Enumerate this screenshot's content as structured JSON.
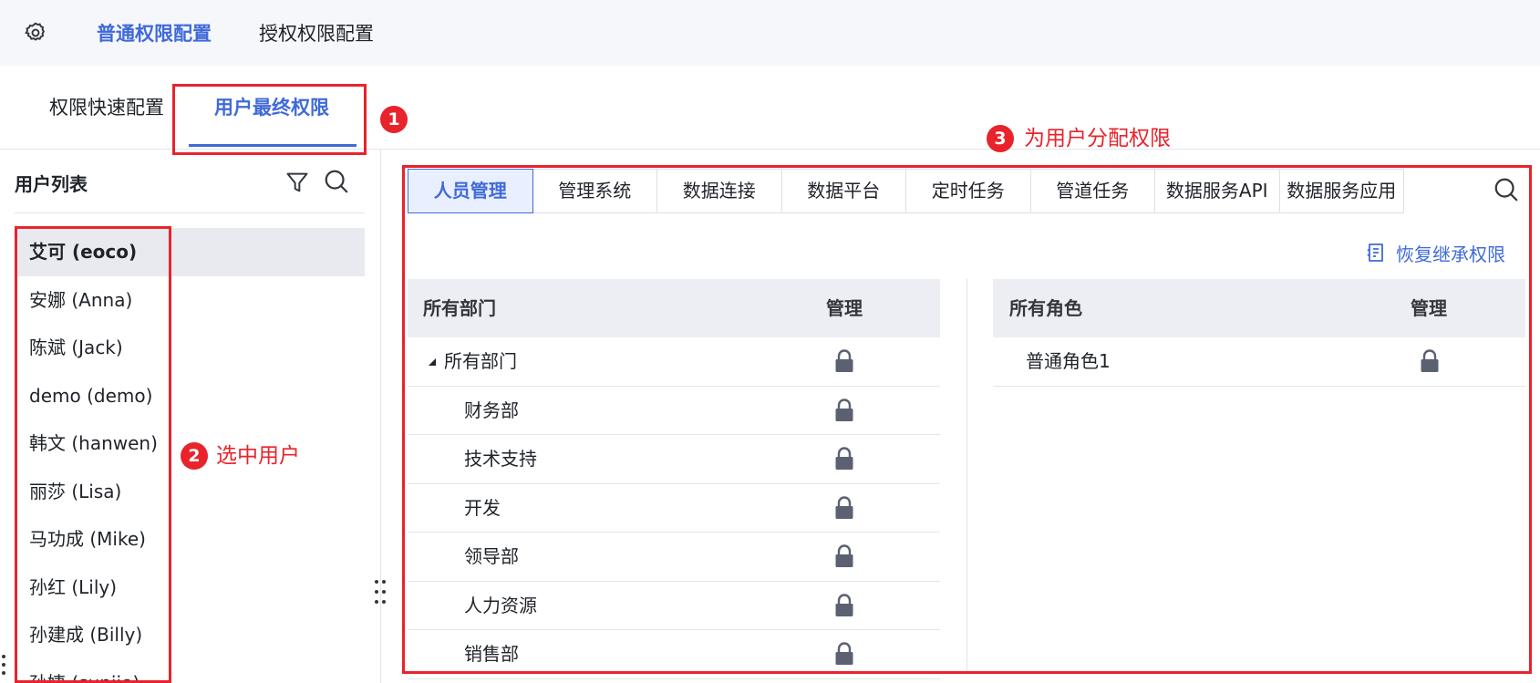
{
  "header": {
    "tabs": [
      {
        "label": "普通权限配置",
        "active": true
      },
      {
        "label": "授权权限配置",
        "active": false
      }
    ]
  },
  "subtabs": [
    {
      "label": "权限快速配置",
      "active": false
    },
    {
      "label": "用户最终权限",
      "active": true
    }
  ],
  "user_panel": {
    "title": "用户列表",
    "users": [
      {
        "label": "艾可 (eoco)",
        "selected": true
      },
      {
        "label": "安娜 (Anna)",
        "selected": false
      },
      {
        "label": "陈斌 (Jack)",
        "selected": false
      },
      {
        "label": "demo (demo)",
        "selected": false
      },
      {
        "label": "韩文 (hanwen)",
        "selected": false
      },
      {
        "label": "丽莎 (Lisa)",
        "selected": false
      },
      {
        "label": "马功成 (Mike)",
        "selected": false
      },
      {
        "label": "孙红 (Lily)",
        "selected": false
      },
      {
        "label": "孙建成 (Billy)",
        "selected": false
      },
      {
        "label": "孙婕 (sunjie)",
        "selected": false
      }
    ]
  },
  "annotations": [
    {
      "number": "1",
      "text": ""
    },
    {
      "number": "2",
      "text": "选中用户"
    },
    {
      "number": "3",
      "text": "为用户分配权限"
    }
  ],
  "module_tabs": [
    {
      "label": "人员管理",
      "active": true
    },
    {
      "label": "管理系统",
      "active": false
    },
    {
      "label": "数据连接",
      "active": false
    },
    {
      "label": "数据平台",
      "active": false
    },
    {
      "label": "定时任务",
      "active": false
    },
    {
      "label": "管道任务",
      "active": false
    },
    {
      "label": "数据服务API",
      "active": false
    },
    {
      "label": "数据服务应用",
      "active": false
    }
  ],
  "restore_label": "恢复继承权限",
  "dept_table": {
    "headers": [
      "所有部门",
      "管理"
    ],
    "rows": [
      {
        "name": "所有部门",
        "level": 0,
        "expanded": true,
        "permission": "locked"
      },
      {
        "name": "财务部",
        "level": 1,
        "permission": "locked"
      },
      {
        "name": "技术支持",
        "level": 1,
        "permission": "locked"
      },
      {
        "name": "开发",
        "level": 1,
        "permission": "locked"
      },
      {
        "name": "领导部",
        "level": 1,
        "permission": "locked"
      },
      {
        "name": "人力资源",
        "level": 1,
        "permission": "locked"
      },
      {
        "name": "销售部",
        "level": 1,
        "permission": "locked"
      }
    ]
  },
  "role_table": {
    "headers": [
      "所有角色",
      "管理"
    ],
    "rows": [
      {
        "name": "普通角色1",
        "permission": "locked"
      }
    ]
  },
  "colors": {
    "accent": "#3f6ad8",
    "annotation": "#e8232c",
    "header_bg": "#eceef3",
    "lock": "#5b6170"
  }
}
